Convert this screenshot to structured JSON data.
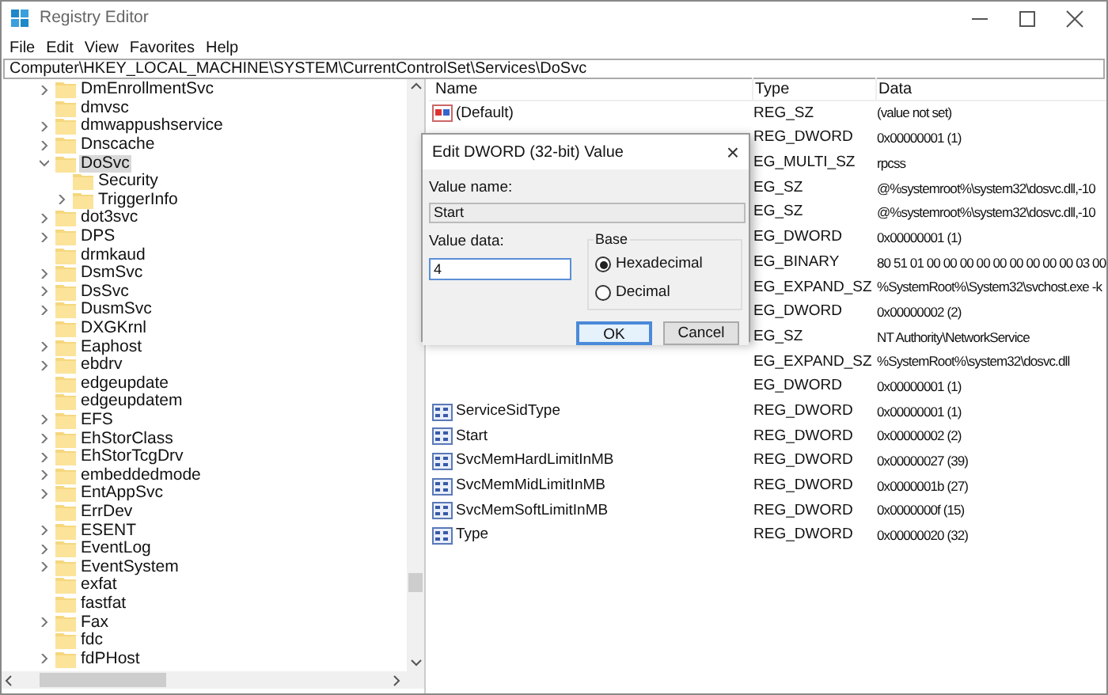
{
  "window": {
    "title": "Registry Editor"
  },
  "menu": [
    "File",
    "Edit",
    "View",
    "Favorites",
    "Help"
  ],
  "address": "Computer\\HKEY_LOCAL_MACHINE\\SYSTEM\\CurrentControlSet\\Services\\DoSvc",
  "tree": [
    {
      "label": "DmEnrollmentSvc",
      "has_children": true,
      "selected": false
    },
    {
      "label": "dmvsc",
      "has_children": false,
      "selected": false
    },
    {
      "label": "dmwappushservice",
      "has_children": true,
      "selected": false
    },
    {
      "label": "Dnscache",
      "has_children": true,
      "selected": false
    },
    {
      "label": "DoSvc",
      "has_children": true,
      "selected": true,
      "expanded": true,
      "children": [
        {
          "label": "Security",
          "has_children": false,
          "selected": false
        },
        {
          "label": "TriggerInfo",
          "has_children": true,
          "selected": false
        }
      ]
    },
    {
      "label": "dot3svc",
      "has_children": true,
      "selected": false
    },
    {
      "label": "DPS",
      "has_children": true,
      "selected": false
    },
    {
      "label": "drmkaud",
      "has_children": false,
      "selected": false
    },
    {
      "label": "DsmSvc",
      "has_children": true,
      "selected": false
    },
    {
      "label": "DsSvc",
      "has_children": true,
      "selected": false
    },
    {
      "label": "DusmSvc",
      "has_children": true,
      "selected": false
    },
    {
      "label": "DXGKrnl",
      "has_children": false,
      "selected": false
    },
    {
      "label": "Eaphost",
      "has_children": true,
      "selected": false
    },
    {
      "label": "ebdrv",
      "has_children": true,
      "selected": false
    },
    {
      "label": "edgeupdate",
      "has_children": false,
      "selected": false
    },
    {
      "label": "edgeupdatem",
      "has_children": false,
      "selected": false
    },
    {
      "label": "EFS",
      "has_children": true,
      "selected": false
    },
    {
      "label": "EhStorClass",
      "has_children": true,
      "selected": false
    },
    {
      "label": "EhStorTcgDrv",
      "has_children": true,
      "selected": false
    },
    {
      "label": "embeddedmode",
      "has_children": true,
      "selected": false
    },
    {
      "label": "EntAppSvc",
      "has_children": true,
      "selected": false
    },
    {
      "label": "ErrDev",
      "has_children": false,
      "selected": false
    },
    {
      "label": "ESENT",
      "has_children": true,
      "selected": false
    },
    {
      "label": "EventLog",
      "has_children": true,
      "selected": false
    },
    {
      "label": "EventSystem",
      "has_children": true,
      "selected": false
    },
    {
      "label": "exfat",
      "has_children": false,
      "selected": false
    },
    {
      "label": "fastfat",
      "has_children": false,
      "selected": false
    },
    {
      "label": "Fax",
      "has_children": true,
      "selected": false
    },
    {
      "label": "fdc",
      "has_children": false,
      "selected": false
    },
    {
      "label": "fdPHost",
      "has_children": true,
      "selected": false
    }
  ],
  "values": {
    "columns": [
      "Name",
      "Type",
      "Data"
    ],
    "rows": [
      {
        "kind": "string",
        "name": "(Default)",
        "type": "REG_SZ",
        "data": "(value not set)"
      },
      {
        "kind": "covered",
        "type": "REG_DWORD",
        "data": "0x00000001 (1)"
      },
      {
        "kind": "covered",
        "type": "EG_MULTI_SZ",
        "data": "rpcss"
      },
      {
        "kind": "covered",
        "type": "EG_SZ",
        "data": "@%systemroot%\\system32\\dosvc.dll,-10"
      },
      {
        "kind": "covered",
        "type": "EG_SZ",
        "data": "@%systemroot%\\system32\\dosvc.dll,-10"
      },
      {
        "kind": "covered",
        "type": "EG_DWORD",
        "data": "0x00000001 (1)"
      },
      {
        "kind": "covered",
        "type": "EG_BINARY",
        "data": "80 51 01 00 00 00 00 00 00 00 00 00 03 00"
      },
      {
        "kind": "covered",
        "type": "EG_EXPAND_SZ",
        "data": "%SystemRoot%\\System32\\svchost.exe -k"
      },
      {
        "kind": "covered",
        "type": "EG_DWORD",
        "data": "0x00000002 (2)"
      },
      {
        "kind": "covered",
        "type": "EG_SZ",
        "data": "NT Authority\\NetworkService"
      },
      {
        "kind": "covered",
        "type": "EG_EXPAND_SZ",
        "data": "%SystemRoot%\\system32\\dosvc.dll"
      },
      {
        "kind": "covered",
        "type": "EG_DWORD",
        "data": "0x00000001 (1)"
      },
      {
        "kind": "binary",
        "name": "ServiceSidType",
        "type": "REG_DWORD",
        "data": "0x00000001 (1)"
      },
      {
        "kind": "binary",
        "name": "Start",
        "type": "REG_DWORD",
        "data": "0x00000002 (2)"
      },
      {
        "kind": "binary",
        "name": "SvcMemHardLimitInMB",
        "type": "REG_DWORD",
        "data": "0x00000027 (39)"
      },
      {
        "kind": "binary",
        "name": "SvcMemMidLimitInMB",
        "type": "REG_DWORD",
        "data": "0x0000001b (27)"
      },
      {
        "kind": "binary",
        "name": "SvcMemSoftLimitInMB",
        "type": "REG_DWORD",
        "data": "0x0000000f (15)"
      },
      {
        "kind": "binary",
        "name": "Type",
        "type": "REG_DWORD",
        "data": "0x00000020 (32)"
      }
    ]
  },
  "dialog": {
    "title": "Edit DWORD (32-bit) Value",
    "close": "×",
    "value_name_label": "Value name:",
    "value_name": "Start",
    "value_data_label": "Value data:",
    "value_data": "4",
    "base_label": "Base",
    "bases": [
      {
        "label": "Hexadecimal",
        "selected": true
      },
      {
        "label": "Decimal",
        "selected": false
      }
    ],
    "buttons": [
      {
        "label": "OK",
        "default": true
      },
      {
        "label": "Cancel",
        "default": false
      }
    ]
  }
}
